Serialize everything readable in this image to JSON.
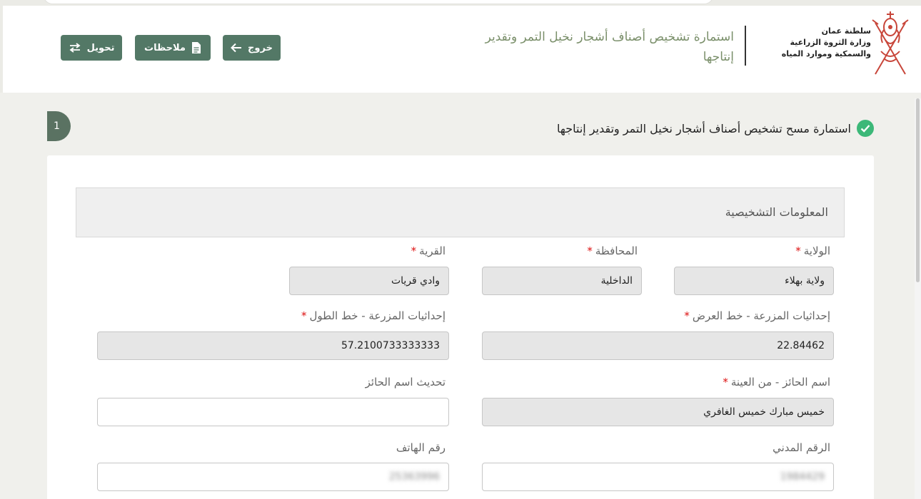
{
  "header": {
    "ministry_line1": "سلطنة عمان",
    "ministry_line2": "وزارة الثروة الزراعية والسمكية وموارد المياه",
    "form_title": "استمارة تشخيص أصناف أشجار نخيل التمر وتقدير إنتاجها"
  },
  "toolbar": {
    "exit_label": "خروج",
    "notes_label": "ملاحظات",
    "transfer_label": "تحويل"
  },
  "step": {
    "number": "1",
    "title": "استمارة مسح تشخيص أصناف أشجار نخيل التمر وتقدير إنتاجها"
  },
  "section": {
    "title": "المعلومات التشخيصية"
  },
  "required_mark": "*",
  "fields": {
    "wilayat": {
      "label": "الولاية",
      "value": "ولاية بهلاء"
    },
    "governorate": {
      "label": "المحافظة",
      "value": "الداخلية"
    },
    "village": {
      "label": "القرية",
      "value": "وادي قريات"
    },
    "latitude": {
      "label": "إحداثيات المزرعة - خط العرض",
      "value": "22.84462"
    },
    "longitude": {
      "label": "إحداثيات المزرعة - خط الطول",
      "value": "57.2100733333333"
    },
    "holder_name": {
      "label": "اسم الحائز - من العينة",
      "value": "خميس مبارك خميس الغافري"
    },
    "update_holder": {
      "label": "تحديث اسم الحائز",
      "value": ""
    },
    "civil_id": {
      "label": "الرقم المدني",
      "value": "1984429"
    },
    "phone": {
      "label": "رقم الهاتف",
      "value": "25363996"
    }
  },
  "icons": {
    "emblem": "oman-emblem-icon",
    "exit": "arrow-left-icon",
    "notes": "document-icon",
    "transfer": "swap-arrows-icon",
    "check": "check-circle-icon"
  },
  "colors": {
    "button": "#537866",
    "title_green": "#7a8f6a",
    "check": "#3cb878",
    "required": "#dd1111"
  }
}
